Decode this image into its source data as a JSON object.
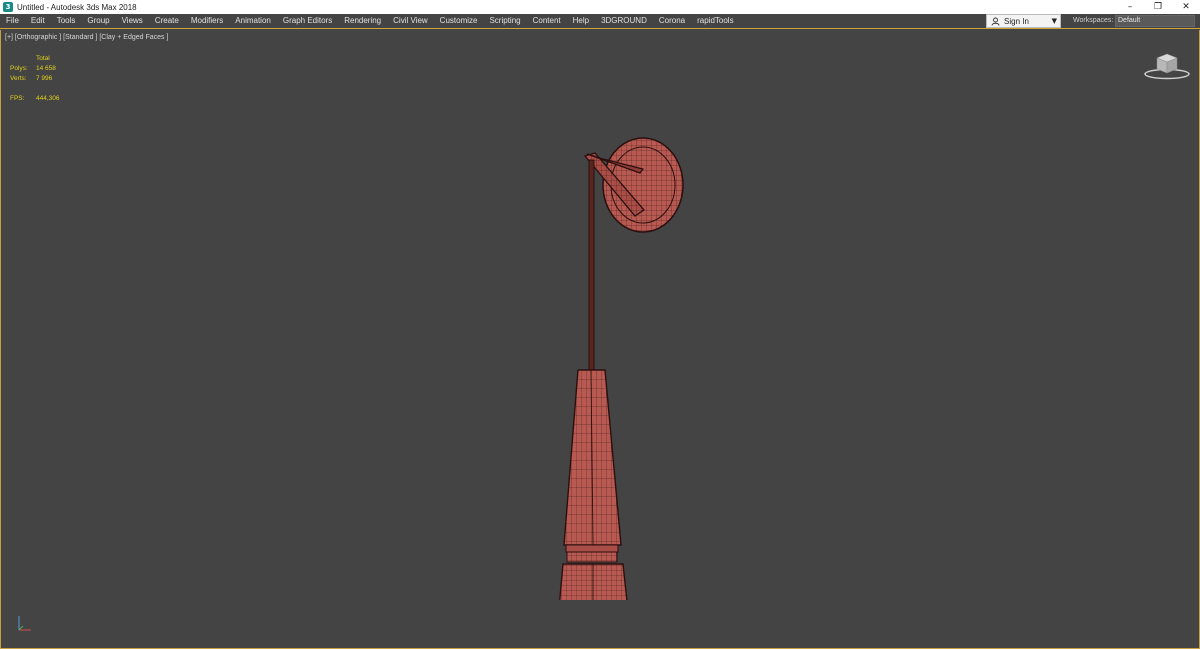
{
  "window": {
    "title": "Untitled - Autodesk 3ds Max 2018",
    "app_icon_glyph": "3",
    "controls": {
      "minimize": "–",
      "restore": "❐",
      "close": "✕"
    }
  },
  "menu": {
    "items": [
      "File",
      "Edit",
      "Tools",
      "Group",
      "Views",
      "Create",
      "Modifiers",
      "Animation",
      "Graph Editors",
      "Rendering",
      "Civil View",
      "Customize",
      "Scripting",
      "Content",
      "Help",
      "3DGROUND",
      "Corona",
      "rapidTools"
    ],
    "sign_in": "Sign In",
    "workspaces_label": "Workspaces:",
    "workspaces_value": "Default"
  },
  "viewport": {
    "label": "[+] [Orthographic ] [Standard ] [Clay + Edged Faces ]",
    "stats": {
      "total_label": "Total",
      "polys_label": "Polys:",
      "polys_value": "14 658",
      "verts_label": "Verts:",
      "verts_value": "7 996",
      "fps_label": "FPS:",
      "fps_value": "444,306"
    },
    "background_color": "#444444",
    "model_color": "#b85a52",
    "stats_color": "#e2d21c",
    "active_border_color": "#c9a040"
  }
}
